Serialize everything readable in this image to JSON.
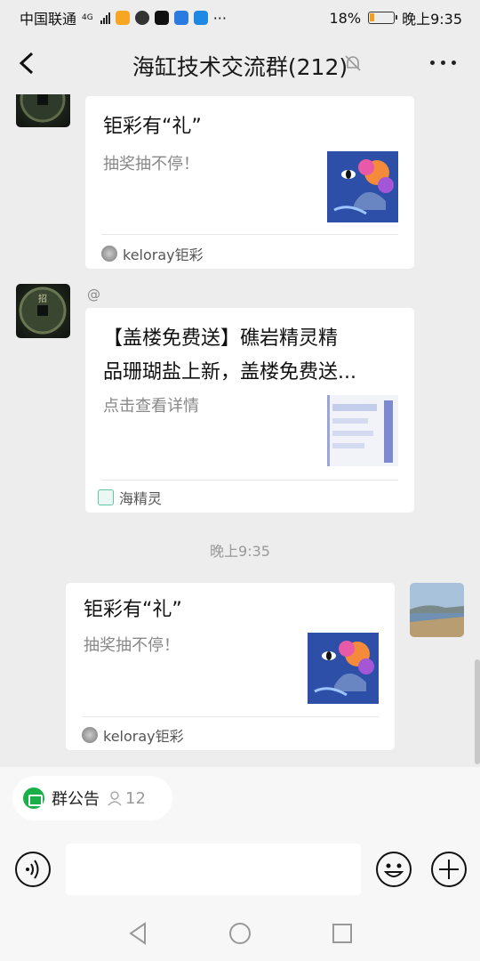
{
  "status": {
    "carrier": "中国联通",
    "net": "4G",
    "battery": "18%",
    "time": "晚上9:35"
  },
  "header": {
    "title": "海缸技术交流群(212)"
  },
  "messages": [
    {
      "title": "钜彩有“礼”",
      "desc": "抽奖抽不停！",
      "source": "keloray钜彩"
    },
    {
      "mention": "@",
      "title_line1": "【盖楼免费送】礁岩精灵精",
      "title_line2": "品珊瑚盐上新，盖楼免费送...",
      "desc": "点击查看详情",
      "source": "海精灵"
    },
    {
      "title": "钜彩有“礼”",
      "desc": "抽奖抽不停！",
      "source": "keloray钜彩"
    }
  ],
  "timestamp": "晚上9:35",
  "notice": {
    "label": "群公告",
    "count": "12"
  },
  "colors": {
    "bg": "#ededed",
    "accent": "#19b04a",
    "battery": "#f0a020"
  },
  "icons": [
    "back-icon",
    "mute-icon",
    "more-icon",
    "voice-icon",
    "emoji-icon",
    "plus-icon",
    "nav-back-icon",
    "nav-home-icon",
    "nav-recent-icon"
  ]
}
